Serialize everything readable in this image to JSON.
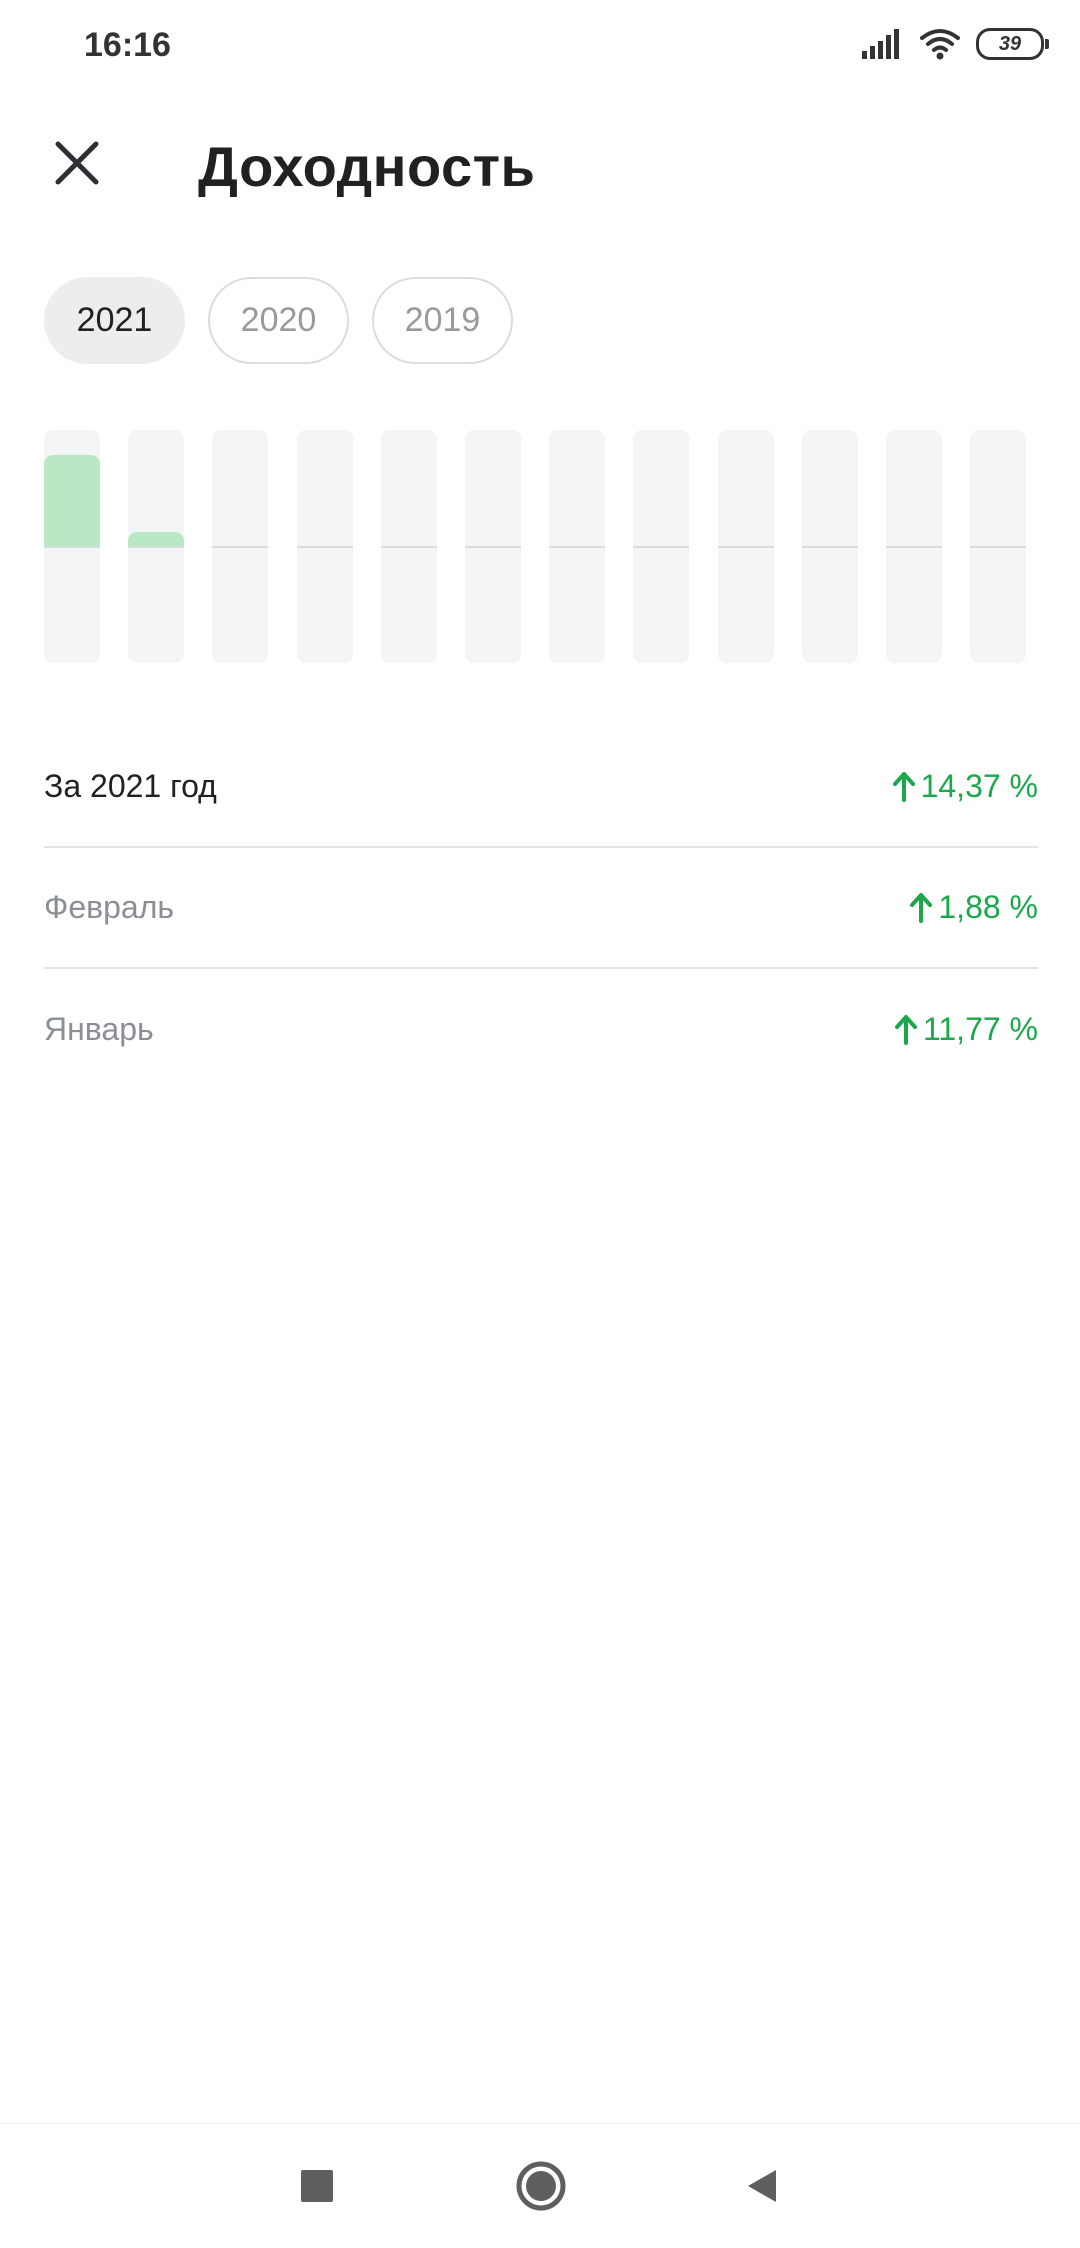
{
  "status_bar": {
    "time": "16:16",
    "battery": "39"
  },
  "header": {
    "title": "Доходность"
  },
  "years": [
    {
      "label": "2021",
      "active": true
    },
    {
      "label": "2020",
      "active": false
    },
    {
      "label": "2019",
      "active": false
    }
  ],
  "chart_data": {
    "type": "bar",
    "categories": [
      "",
      "",
      "",
      "",
      "",
      "",
      "",
      "",
      "",
      "",
      "",
      ""
    ],
    "values": [
      11.77,
      1.88,
      0,
      0,
      0,
      0,
      0,
      0,
      0,
      0,
      0,
      0
    ],
    "title": "",
    "xlabel": "",
    "ylabel": "",
    "ylim": [
      -15,
      15
    ],
    "colors": {
      "positive": "#b8e9c4",
      "track": "#f4f5f6"
    }
  },
  "rows": [
    {
      "label": "За 2021 год",
      "value": "14,37 %",
      "muted": false
    },
    {
      "label": "Февраль",
      "value": "1,88 %",
      "muted": true
    },
    {
      "label": "Январь",
      "value": "11,77 %",
      "muted": true
    }
  ],
  "colors": {
    "accent_green": "#1aa84a"
  },
  "nav": {
    "icons": [
      "recents-square-icon",
      "home-circle-icon",
      "back-triangle-icon"
    ]
  }
}
